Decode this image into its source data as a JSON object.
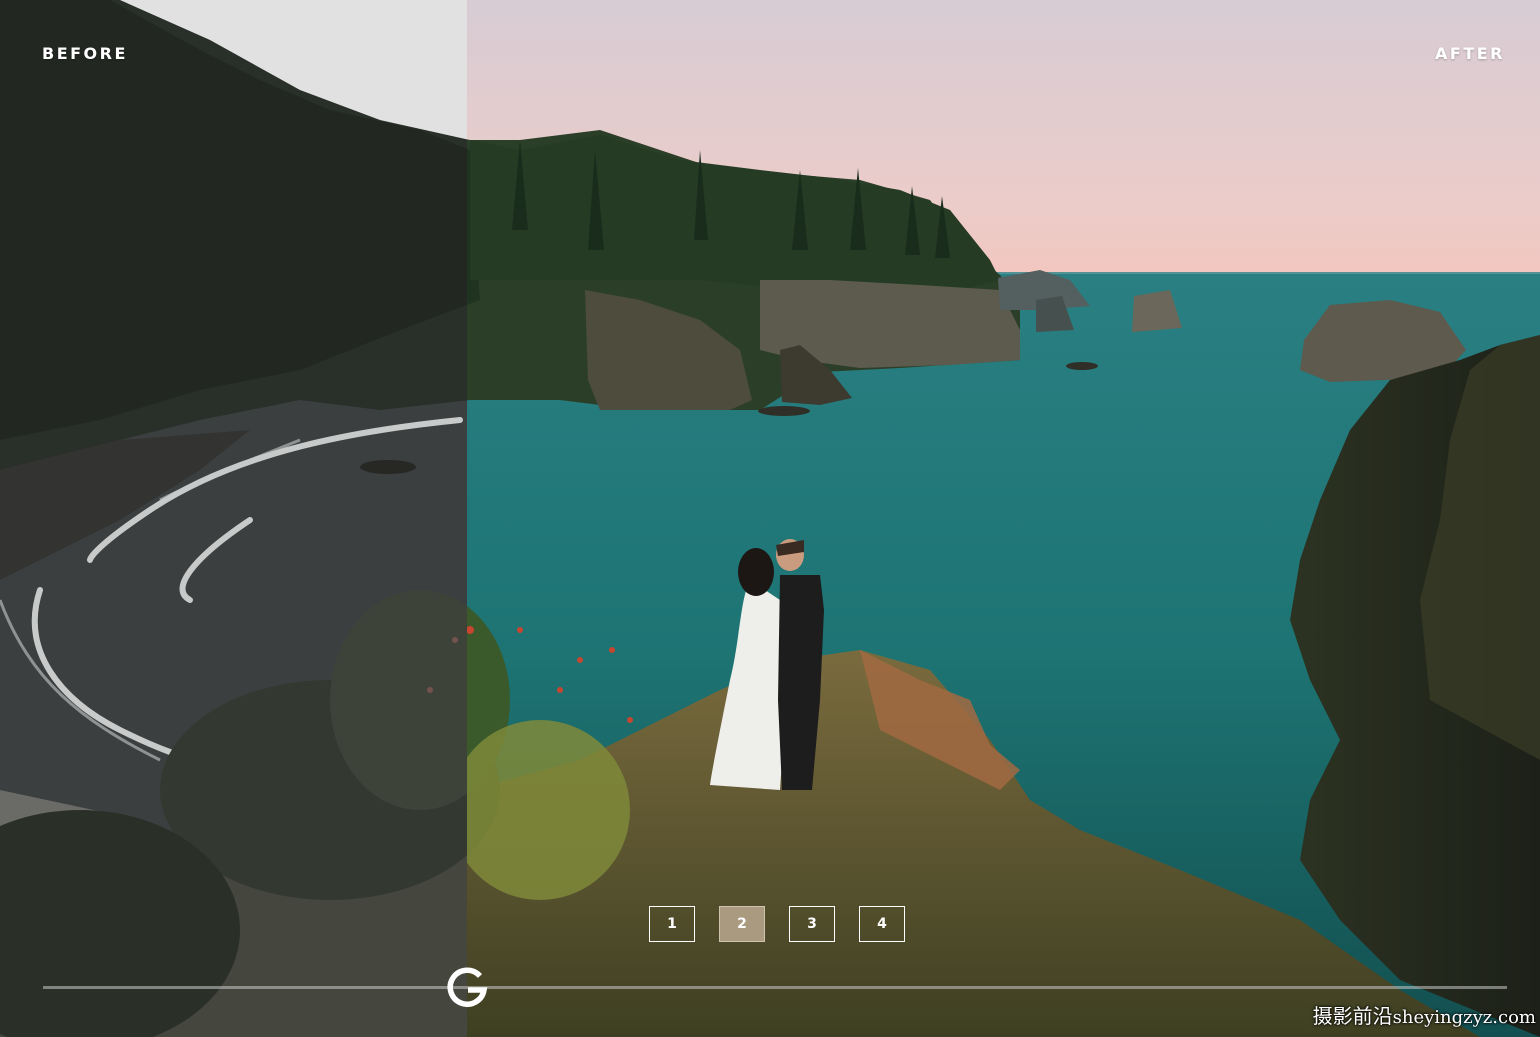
{
  "labels": {
    "before": "BEFORE",
    "after": "AFTER"
  },
  "pagination": {
    "pages": [
      "1",
      "2",
      "3",
      "4"
    ],
    "active_index": 1
  },
  "slider": {
    "handle_logo": "G",
    "position_fraction": 0.303
  },
  "watermark": {
    "cjk": "摄影前沿",
    "latin": "sheyingzyz.com"
  },
  "colors": {
    "active_page_bg": "#a99a80",
    "sky_top": "#d9cdd3",
    "sky_horizon": "#f0c9c4",
    "ocean": "#1f7b78",
    "forest": "#26402a"
  },
  "icons": {
    "slider_handle": "g-logo-icon"
  }
}
